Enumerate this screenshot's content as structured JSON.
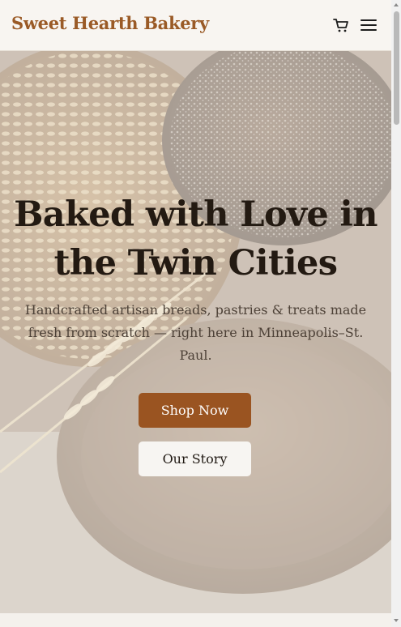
{
  "header": {
    "brand": "Sweet Hearth Bakery",
    "icons": [
      "cart-icon",
      "menu-icon"
    ]
  },
  "hero": {
    "title_line1": "Baked with Love in",
    "title_line2": "the Twin Cities",
    "subtitle": "Handcrafted artisan breads, pastries & treats made fresh from scratch — right here in Minneapolis–St. Paul.",
    "primary_cta": "Shop Now",
    "secondary_cta": "Our Story",
    "background_image": "artisan bread loaves with wheat stalks"
  },
  "colors": {
    "brand": "#9a5a26",
    "primary_button": "#9a5421",
    "heading": "#231a12",
    "body_text": "#4d4137"
  }
}
